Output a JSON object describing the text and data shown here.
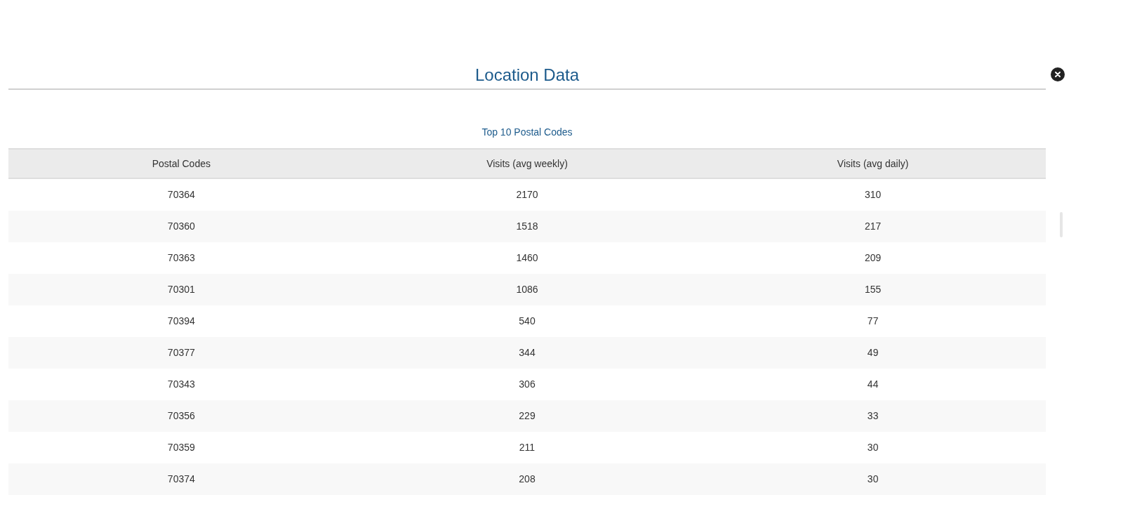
{
  "dialog": {
    "title": "Location Data"
  },
  "table": {
    "caption": "Top 10 Postal Codes",
    "columns": [
      "Postal Codes",
      "Visits (avg weekly)",
      "Visits (avg daily)"
    ],
    "rows": [
      [
        "70364",
        "2170",
        "310"
      ],
      [
        "70360",
        "1518",
        "217"
      ],
      [
        "70363",
        "1460",
        "209"
      ],
      [
        "70301",
        "1086",
        "155"
      ],
      [
        "70394",
        "540",
        "77"
      ],
      [
        "70377",
        "344",
        "49"
      ],
      [
        "70343",
        "306",
        "44"
      ],
      [
        "70356",
        "229",
        "33"
      ],
      [
        "70359",
        "211",
        "30"
      ],
      [
        "70374",
        "208",
        "30"
      ]
    ]
  }
}
